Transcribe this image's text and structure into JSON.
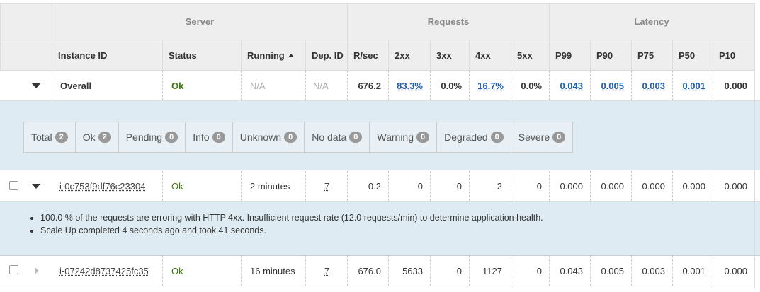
{
  "groups": {
    "server": "Server",
    "requests": "Requests",
    "latency": "Latency"
  },
  "columns": {
    "instance_id": "Instance ID",
    "status": "Status",
    "running": "Running",
    "dep_id": "Dep. ID",
    "rsec": "R/sec",
    "c2xx": "2xx",
    "c3xx": "3xx",
    "c4xx": "4xx",
    "c5xx": "5xx",
    "p99": "P99",
    "p90": "P90",
    "p75": "P75",
    "p50": "P50",
    "p10": "P10",
    "running_sort_icon": "sort-ascending-icon"
  },
  "overall": {
    "name": "Overall",
    "status": "Ok",
    "running": "N/A",
    "dep_id": "N/A",
    "rsec": "676.2",
    "c2xx": "83.3%",
    "c3xx": "0.0%",
    "c4xx": "16.7%",
    "c5xx": "0.0%",
    "p99": "0.043",
    "p90": "0.005",
    "p75": "0.003",
    "p50": "0.001",
    "p10": "0.000"
  },
  "filters": [
    {
      "label": "Total",
      "count": "2"
    },
    {
      "label": "Ok",
      "count": "2"
    },
    {
      "label": "Pending",
      "count": "0"
    },
    {
      "label": "Info",
      "count": "0"
    },
    {
      "label": "Unknown",
      "count": "0"
    },
    {
      "label": "No data",
      "count": "0"
    },
    {
      "label": "Warning",
      "count": "0"
    },
    {
      "label": "Degraded",
      "count": "0"
    },
    {
      "label": "Severe",
      "count": "0"
    }
  ],
  "instances": [
    {
      "id": "i-0c753f9df76c23304",
      "status": "Ok",
      "running": "2 minutes",
      "dep_id": "7",
      "rsec": "0.2",
      "c2xx": "0",
      "c3xx": "0",
      "c4xx": "2",
      "c5xx": "0",
      "p99": "0.000",
      "p90": "0.000",
      "p75": "0.000",
      "p50": "0.000",
      "p10": "0.000",
      "messages": [
        "100.0 % of the requests are erroring with HTTP 4xx. Insufficient request rate (12.0 requests/min) to determine application health.",
        "Scale Up completed 4 seconds ago and took 41 seconds."
      ]
    },
    {
      "id": "i-07242d8737425fc35",
      "status": "Ok",
      "running": "16 minutes",
      "dep_id": "7",
      "rsec": "676.0",
      "c2xx": "5633",
      "c3xx": "0",
      "c4xx": "1127",
      "c5xx": "0",
      "p99": "0.043",
      "p90": "0.005",
      "p75": "0.003",
      "p50": "0.001",
      "p10": "0.000"
    }
  ]
}
